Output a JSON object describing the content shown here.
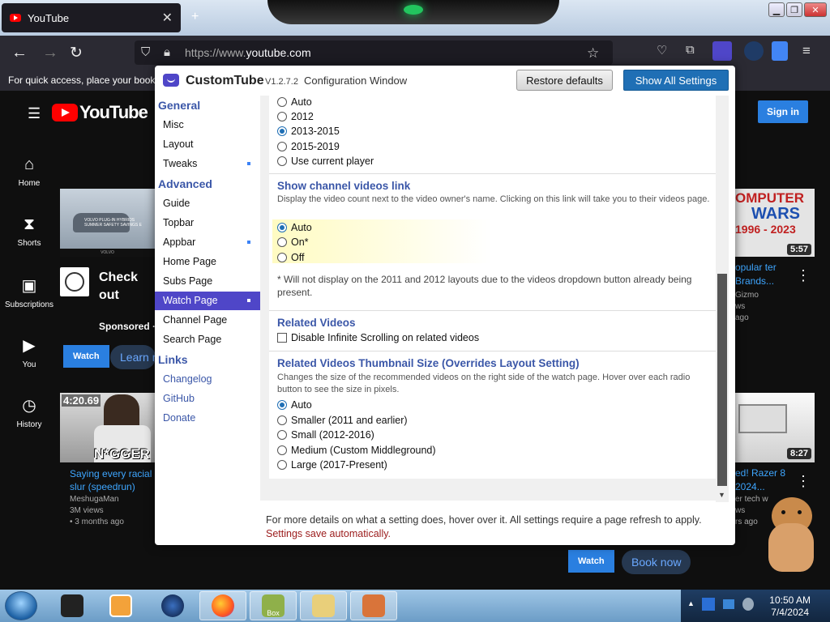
{
  "browser": {
    "tab_title": "YouTube",
    "tab_close": "✕",
    "new_tab": "+",
    "url_prefix": "https://www.",
    "url_domain": "youtube.com",
    "bookmarks_hint": "For quick access, place your bookmarks here on the bookmarks toolbar."
  },
  "youtube": {
    "logo_text": "YouTube",
    "signin": "Sign in",
    "sidebar": [
      {
        "icon": "home-icon",
        "label": "Home"
      },
      {
        "icon": "shorts-icon",
        "label": "Shorts"
      },
      {
        "icon": "subscriptions-icon",
        "label": "Subscriptions"
      },
      {
        "icon": "you-icon",
        "label": "You"
      },
      {
        "icon": "history-icon",
        "label": "History"
      }
    ],
    "ad_title": "Check out Volvo...",
    "ad_sponsored": "Sponsored · ",
    "ad_watch": "Watch",
    "ad_learn": "Learn more",
    "ad_thumb_text": "VOLVO PLUG-IN HYBRIDS SUMMER SAFETY SAVINGS E",
    "ad_brand": "VOLVO",
    "video1": {
      "duration": "4:20.69",
      "thumb_text": "N*GGER",
      "title": "Saying every racial slur (speedrun)",
      "channel": "MeshugaMan",
      "views": "3M views",
      "age": "• 3 months ago"
    },
    "right_video1": {
      "thumb_top": "OMPUTER",
      "thumb_mid": "WARS",
      "thumb_bottom": "1996 - 2023",
      "duration": "5:57",
      "title": "opular ter Brands...",
      "channel": "Gizmo",
      "views": "ws",
      "age": "ago"
    },
    "right_video2": {
      "duration": "8:27",
      "title": "ed! Razer 8 2024...",
      "channel": "er tech w",
      "views": "ws",
      "age": "rs ago"
    },
    "bottom_watch": "Watch",
    "bottom_book": "Book now"
  },
  "dialog": {
    "title": "CustomTube",
    "version": "V1.2.7.2",
    "subtitle": "Configuration Window",
    "restore": "Restore defaults",
    "show_all": "Show All Settings",
    "nav": {
      "general": "General",
      "general_items": [
        "Misc",
        "Layout",
        "Tweaks"
      ],
      "advanced": "Advanced",
      "advanced_items": [
        "Guide",
        "Topbar",
        "Appbar",
        "Home Page",
        "Subs Page",
        "Watch Page",
        "Channel Page",
        "Search Page"
      ],
      "links": "Links",
      "link_items": [
        "Changelog",
        "GitHub",
        "Donate"
      ]
    },
    "layout_options": [
      {
        "label": "Auto",
        "selected": false
      },
      {
        "label": "2012",
        "selected": false
      },
      {
        "label": "2013-2015",
        "selected": true
      },
      {
        "label": "2015-2019",
        "selected": false
      },
      {
        "label": "Use current player",
        "selected": false
      }
    ],
    "channel_link": {
      "title": "Show channel videos link",
      "desc": "Display the video count next to the video owner's name. Clicking on this link will take you to their videos page.",
      "options": [
        {
          "label": "Auto",
          "selected": true
        },
        {
          "label": "On*",
          "selected": false
        },
        {
          "label": "Off",
          "selected": false
        }
      ],
      "note": "* Will not display on the 2011 and 2012 layouts due to the videos dropdown button already being present."
    },
    "related": {
      "title": "Related Videos",
      "checkbox": "Disable Infinite Scrolling on related videos",
      "checked": false
    },
    "thumb_size": {
      "title": "Related Videos Thumbnail Size (Overrides Layout Setting)",
      "desc": "Changes the size of the recommended videos on the right side of the watch page. Hover over each radio button to see the size in pixels.",
      "options": [
        {
          "label": "Auto",
          "selected": true
        },
        {
          "label": "Smaller (2011 and earlier)",
          "selected": false
        },
        {
          "label": "Small (2012-2016)",
          "selected": false
        },
        {
          "label": "Medium (Custom Middleground)",
          "selected": false
        },
        {
          "label": "Large (2017-Present)",
          "selected": false
        }
      ]
    },
    "footer": "For more details on what a setting does, hover over it. All settings require a page refresh to apply.",
    "footer_red": "Settings save automatically."
  },
  "taskbar": {
    "time": "10:50 AM",
    "date": "7/4/2024",
    "box_label": "Box"
  },
  "colors": {
    "accent": "#4f46c8",
    "link": "#3b57a8",
    "primary_button": "#1f6fb5",
    "youtube_red": "#ff0000"
  }
}
